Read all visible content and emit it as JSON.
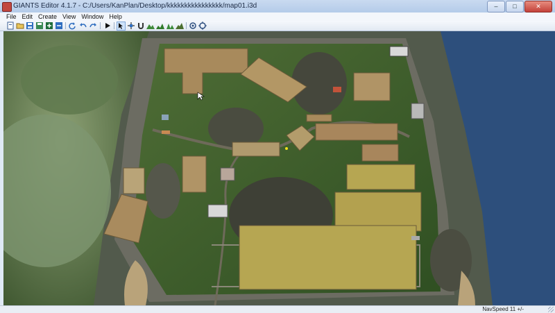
{
  "window": {
    "title": "GIANTS Editor 4.1.7 - C:/Users/KanPlan/Desktop/kkkkkkkkkkkkkkkk/map01.i3d",
    "buttons": {
      "minimize": "–",
      "maximize": "□",
      "close": "✕"
    }
  },
  "menu": [
    "File",
    "Edit",
    "Create",
    "View",
    "Window",
    "Help"
  ],
  "toolbar": {
    "icons": [
      "new-file-icon",
      "open-folder-icon",
      "save-icon",
      "save-as-icon",
      "import-icon",
      "export-icon",
      "refresh-icon",
      "undo-icon",
      "redo-icon",
      "play-icon",
      "select-icon",
      "move-icon",
      "magnet-icon",
      "terrain-sculpt-icon",
      "paint-icon",
      "foliage-icon",
      "mountain-icon",
      "camera-icon",
      "camera-target-icon"
    ],
    "colors": {
      "accent": "#2f6ec0",
      "green": "#3f8a3a"
    }
  },
  "viewport": {
    "colors": {
      "water": "#2d4f7c",
      "grass": "#3d5e2a",
      "rock": "#6c6c62",
      "field_brown": "#a88a5c",
      "field_yellow": "#b6a652"
    }
  },
  "status": {
    "nav_speed": "NavSpeed 11 +/-"
  }
}
